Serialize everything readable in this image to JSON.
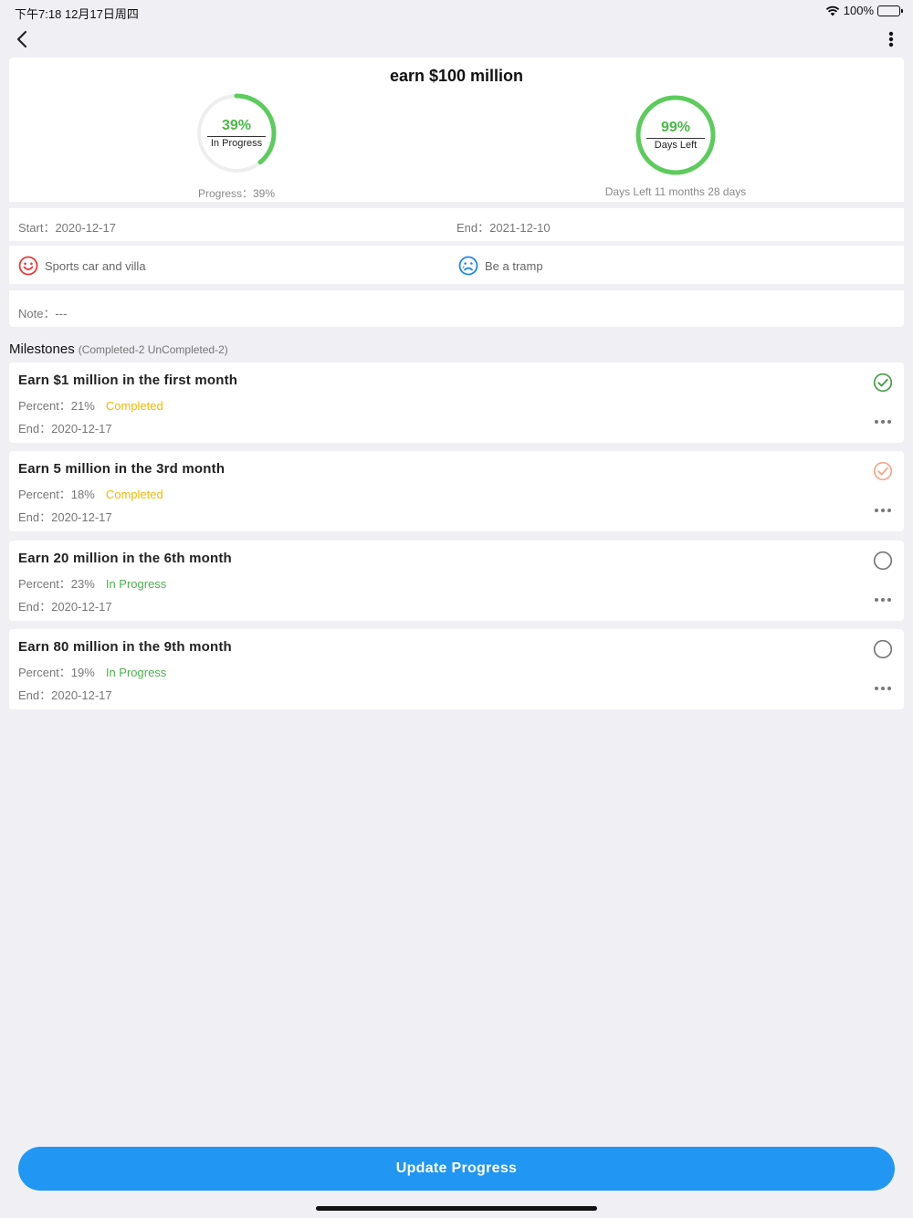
{
  "status_bar": {
    "time": "下午7:18   12月17日周四",
    "battery": "100%"
  },
  "goal": {
    "title": "earn $100 million",
    "progress": {
      "percent_text": "39%",
      "label": "In Progress",
      "caption": "Progress：39%",
      "value": 0.39,
      "color": "#5ccc5c"
    },
    "days_left": {
      "percent_text": "99%",
      "label": "Days Left",
      "caption": "Days Left   11 months 28 days",
      "value": 0.99,
      "color": "#5ccc5c"
    },
    "start": "Start：2020-12-17",
    "end": "End：2021-12-10",
    "reward": "Sports car and villa",
    "punishment": "Be a tramp",
    "note": "Note：---"
  },
  "milestones": {
    "title": "Milestones",
    "count": "(Completed-2 UnCompleted-2)",
    "items": [
      {
        "title": "Earn $1 million in the first month",
        "percent": "Percent：21%",
        "status": "Completed",
        "end": "End：2020-12-17",
        "check": "checked-green"
      },
      {
        "title": "Earn 5 million in the 3rd month",
        "percent": "Percent：18%",
        "status": "Completed",
        "end": "End：2020-12-17",
        "check": "checked-orange"
      },
      {
        "title": "Earn 20 million in the 6th month",
        "percent": "Percent：23%",
        "status": "In Progress",
        "end": "End：2020-12-17",
        "check": "unchecked"
      },
      {
        "title": "Earn 80 million in the 9th month",
        "percent": "Percent：19%",
        "status": "In Progress",
        "end": "End：2020-12-17",
        "check": "unchecked"
      }
    ]
  },
  "actions": {
    "update_button": "Update Progress"
  },
  "colors": {
    "accent": "#2196f3",
    "green": "#4cb848",
    "completed": "#f5b800",
    "check_green": "#43a047",
    "check_orange": "#f5a78a",
    "reward_icon": "#e53935",
    "punish_icon": "#1e88e5"
  },
  "icons": {
    "back": "chevron-left-icon",
    "more": "vertical-dots-icon",
    "reward": "smile-face-icon",
    "punishment": "sad-face-icon",
    "milestone_more": "horizontal-dots-icon"
  }
}
